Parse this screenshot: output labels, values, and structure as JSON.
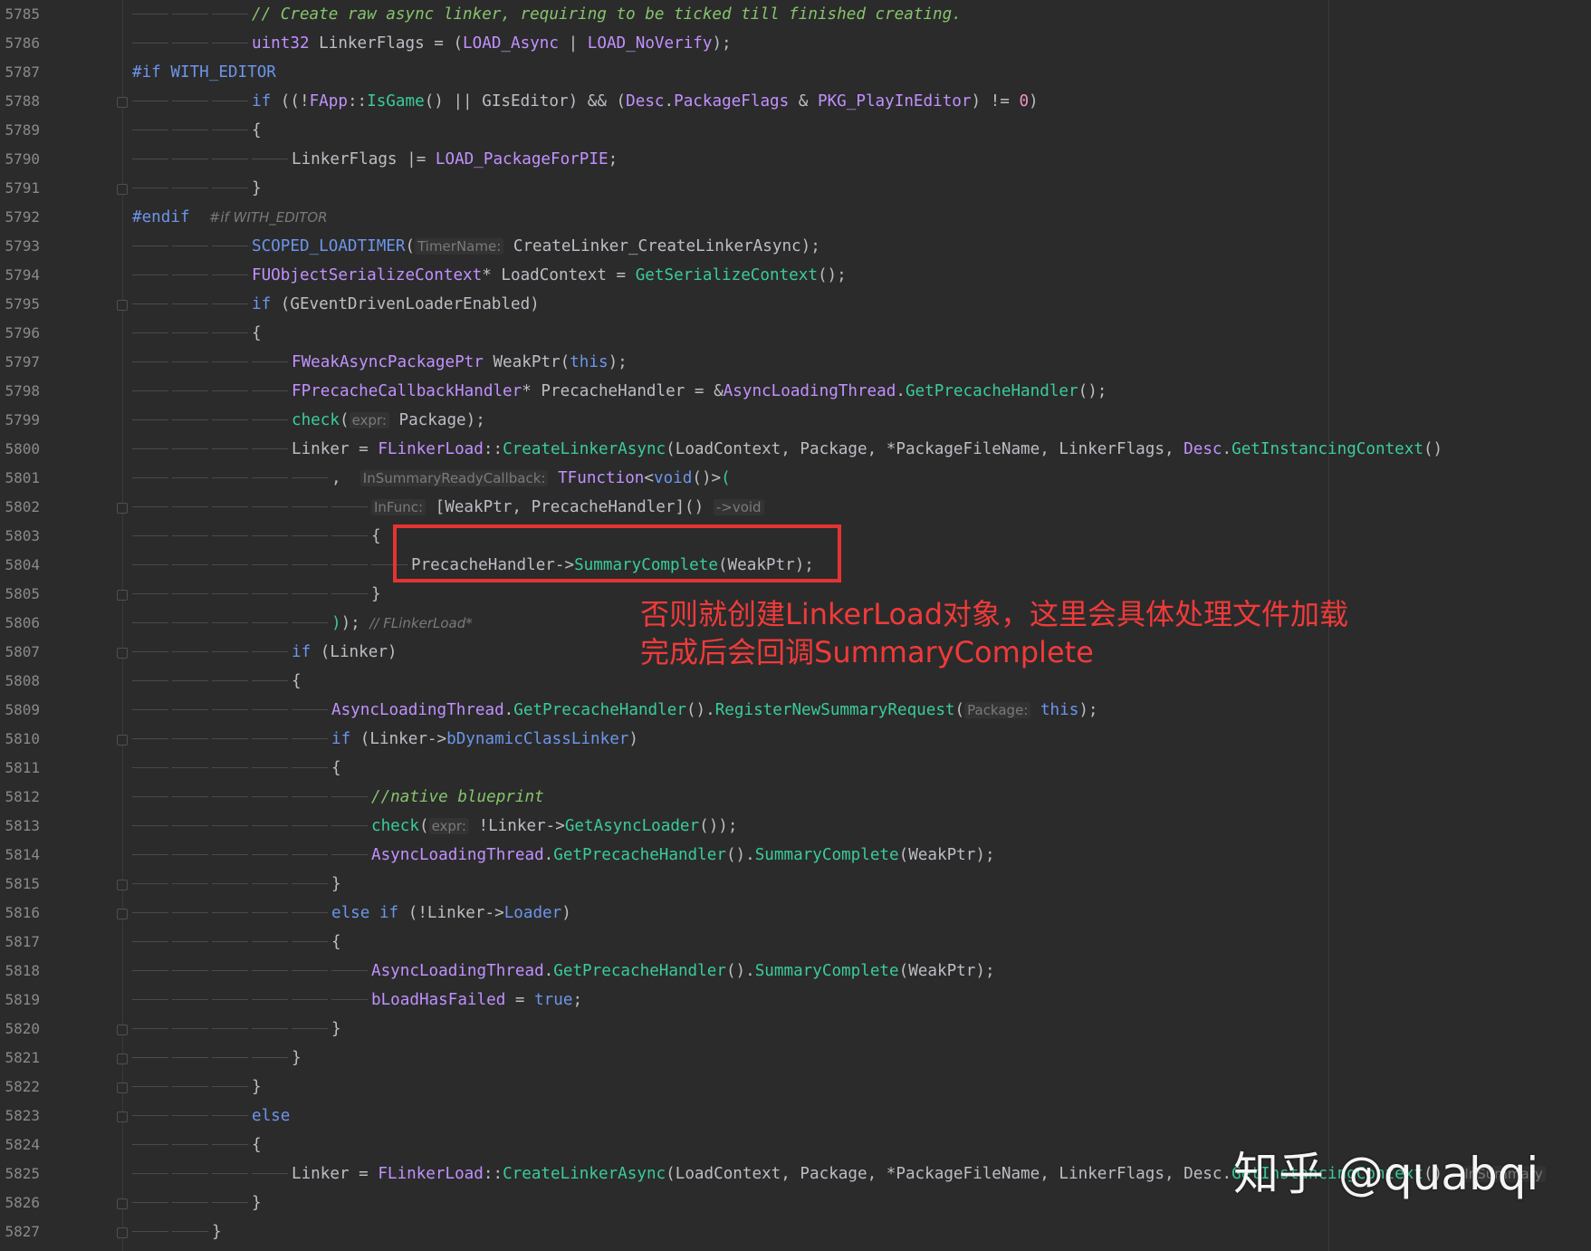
{
  "editor": {
    "lines": [
      {
        "num": "5785",
        "indent": 3,
        "fold": false,
        "tokens": [
          [
            "cm",
            "// Create raw async linker, requiring to be ticked till finished creating."
          ]
        ]
      },
      {
        "num": "5786",
        "indent": 3,
        "fold": false,
        "tokens": [
          [
            "ty",
            "uint32"
          ],
          [
            "pun",
            " LinkerFlags = "
          ],
          [
            "pun",
            "("
          ],
          [
            "ty",
            "LOAD_Async"
          ],
          [
            "pun",
            " | "
          ],
          [
            "ty",
            "LOAD_NoVerify"
          ],
          [
            "pun",
            ");"
          ]
        ]
      },
      {
        "num": "5787",
        "indent": 0,
        "fold": false,
        "tokens": [
          [
            "kw",
            "#if WITH_EDITOR"
          ]
        ]
      },
      {
        "num": "5788",
        "indent": 3,
        "fold": true,
        "tokens": [
          [
            "kw",
            "if"
          ],
          [
            "pun",
            " ((!"
          ],
          [
            "ty",
            "FApp"
          ],
          [
            "pun",
            "::"
          ],
          [
            "fn",
            "IsGame"
          ],
          [
            "pun",
            "() || GIsEditor) && ("
          ],
          [
            "ty",
            "Desc"
          ],
          [
            "pun",
            "."
          ],
          [
            "ty",
            "PackageFlags"
          ],
          [
            "pun",
            " & "
          ],
          [
            "ty",
            "PKG_PlayInEditor"
          ],
          [
            "pun",
            ") != "
          ],
          [
            "num",
            "0"
          ],
          [
            "pun",
            ")"
          ]
        ]
      },
      {
        "num": "5789",
        "indent": 3,
        "fold": false,
        "tokens": [
          [
            "pun",
            "{"
          ]
        ]
      },
      {
        "num": "5790",
        "indent": 4,
        "fold": false,
        "tokens": [
          [
            "pun",
            "LinkerFlags |= "
          ],
          [
            "ty",
            "LOAD_PackageForPIE"
          ],
          [
            "pun",
            ";"
          ]
        ]
      },
      {
        "num": "5791",
        "indent": 3,
        "fold": true,
        "tokens": [
          [
            "pun",
            "}"
          ]
        ]
      },
      {
        "num": "5792",
        "indent": 0,
        "fold": false,
        "tokens": [
          [
            "kw",
            "#endif"
          ],
          [
            "pun",
            "  "
          ],
          [
            "hintc",
            "#if WITH_EDITOR"
          ]
        ]
      },
      {
        "num": "5793",
        "indent": 3,
        "fold": false,
        "tokens": [
          [
            "mac",
            "SCOPED_LOADTIMER"
          ],
          [
            "pun",
            "("
          ],
          [
            "hint",
            "TimerName:"
          ],
          [
            "pun",
            " CreateLinker_CreateLinkerAsync);"
          ]
        ]
      },
      {
        "num": "5794",
        "indent": 3,
        "fold": false,
        "tokens": [
          [
            "ty",
            "FUObjectSerializeContext"
          ],
          [
            "pun",
            "* LoadContext = "
          ],
          [
            "fn",
            "GetSerializeContext"
          ],
          [
            "pun",
            "();"
          ]
        ]
      },
      {
        "num": "5795",
        "indent": 3,
        "fold": true,
        "tokens": [
          [
            "kw",
            "if"
          ],
          [
            "pun",
            " (GEventDrivenLoaderEnabled)"
          ]
        ]
      },
      {
        "num": "5796",
        "indent": 3,
        "fold": false,
        "tokens": [
          [
            "pun",
            "{"
          ]
        ]
      },
      {
        "num": "5797",
        "indent": 4,
        "fold": false,
        "tokens": [
          [
            "ty",
            "FWeakAsyncPackagePtr"
          ],
          [
            "pun",
            " WeakPtr("
          ],
          [
            "kw",
            "this"
          ],
          [
            "pun",
            ");"
          ]
        ]
      },
      {
        "num": "5798",
        "indent": 4,
        "fold": false,
        "tokens": [
          [
            "ty",
            "FPrecacheCallbackHandler"
          ],
          [
            "pun",
            "* PrecacheHandler = &"
          ],
          [
            "ty",
            "AsyncLoadingThread"
          ],
          [
            "pun",
            "."
          ],
          [
            "fn",
            "GetPrecacheHandler"
          ],
          [
            "pun",
            "();"
          ]
        ]
      },
      {
        "num": "5799",
        "indent": 4,
        "fold": false,
        "tokens": [
          [
            "fn",
            "check"
          ],
          [
            "pun",
            "("
          ],
          [
            "hint",
            "expr:"
          ],
          [
            "pun",
            " Package);"
          ]
        ]
      },
      {
        "num": "5800",
        "indent": 4,
        "fold": false,
        "tokens": [
          [
            "pun",
            "Linker = "
          ],
          [
            "ty",
            "FLinkerLoad"
          ],
          [
            "pun",
            "::"
          ],
          [
            "fn",
            "CreateLinkerAsync"
          ],
          [
            "pun",
            "(LoadContext, Package, *PackageFileName, LinkerFlags, "
          ],
          [
            "ty",
            "Desc"
          ],
          [
            "pun",
            "."
          ],
          [
            "fn",
            "GetInstancingContext"
          ],
          [
            "pun",
            "()"
          ]
        ]
      },
      {
        "num": "5801",
        "indent": 5,
        "fold": false,
        "tokens": [
          [
            "pun",
            ",  "
          ],
          [
            "hint",
            "InSummaryReadyCallback:"
          ],
          [
            "pun",
            " "
          ],
          [
            "ty",
            "TFunction"
          ],
          [
            "pun",
            "<"
          ],
          [
            "kw",
            "void"
          ],
          [
            "pun",
            "()>"
          ],
          [
            "fn",
            "("
          ]
        ]
      },
      {
        "num": "5802",
        "indent": 6,
        "fold": true,
        "tokens": [
          [
            "hint",
            "InFunc:"
          ],
          [
            "pun",
            " [WeakPtr, PrecacheHandler]() "
          ],
          [
            "hint",
            "->void"
          ]
        ]
      },
      {
        "num": "5803",
        "indent": 6,
        "fold": false,
        "tokens": [
          [
            "pun",
            "{"
          ]
        ]
      },
      {
        "num": "5804",
        "indent": 7,
        "fold": false,
        "tokens": [
          [
            "pun",
            "PrecacheHandler->"
          ],
          [
            "fn",
            "SummaryComplete"
          ],
          [
            "pun",
            "(WeakPtr);"
          ]
        ]
      },
      {
        "num": "5805",
        "indent": 6,
        "fold": true,
        "tokens": [
          [
            "pun",
            "}"
          ]
        ]
      },
      {
        "num": "5806",
        "indent": 5,
        "fold": false,
        "tokens": [
          [
            "fn",
            ")"
          ],
          [
            "pun",
            "); "
          ],
          [
            "hintc",
            "// FLinkerLoad*"
          ]
        ]
      },
      {
        "num": "5807",
        "indent": 4,
        "fold": true,
        "tokens": [
          [
            "kw",
            "if"
          ],
          [
            "pun",
            " (Linker)"
          ]
        ]
      },
      {
        "num": "5808",
        "indent": 4,
        "fold": false,
        "tokens": [
          [
            "pun",
            "{"
          ]
        ]
      },
      {
        "num": "5809",
        "indent": 5,
        "fold": false,
        "tokens": [
          [
            "ty",
            "AsyncLoadingThread"
          ],
          [
            "pun",
            "."
          ],
          [
            "fn",
            "GetPrecacheHandler"
          ],
          [
            "pun",
            "()."
          ],
          [
            "fn",
            "RegisterNewSummaryRequest"
          ],
          [
            "pun",
            "("
          ],
          [
            "hint",
            "Package:"
          ],
          [
            "pun",
            " "
          ],
          [
            "kw",
            "this"
          ],
          [
            "pun",
            ");"
          ]
        ]
      },
      {
        "num": "5810",
        "indent": 5,
        "fold": true,
        "tokens": [
          [
            "kw",
            "if"
          ],
          [
            "pun",
            " (Linker->"
          ],
          [
            "kw",
            "bDynamicClassLinker"
          ],
          [
            "pun",
            ")"
          ]
        ]
      },
      {
        "num": "5811",
        "indent": 5,
        "fold": false,
        "tokens": [
          [
            "pun",
            "{"
          ]
        ]
      },
      {
        "num": "5812",
        "indent": 6,
        "fold": false,
        "tokens": [
          [
            "cm",
            "//native blueprint"
          ]
        ]
      },
      {
        "num": "5813",
        "indent": 6,
        "fold": false,
        "tokens": [
          [
            "fn",
            "check"
          ],
          [
            "pun",
            "("
          ],
          [
            "hint",
            "expr:"
          ],
          [
            "pun",
            " !Linker->"
          ],
          [
            "fn",
            "GetAsyncLoader"
          ],
          [
            "pun",
            "());"
          ]
        ]
      },
      {
        "num": "5814",
        "indent": 6,
        "fold": false,
        "tokens": [
          [
            "ty",
            "AsyncLoadingThread"
          ],
          [
            "pun",
            "."
          ],
          [
            "fn",
            "GetPrecacheHandler"
          ],
          [
            "pun",
            "()."
          ],
          [
            "fn",
            "SummaryComplete"
          ],
          [
            "pun",
            "(WeakPtr);"
          ]
        ]
      },
      {
        "num": "5815",
        "indent": 5,
        "fold": true,
        "tokens": [
          [
            "pun",
            "}"
          ]
        ]
      },
      {
        "num": "5816",
        "indent": 5,
        "fold": true,
        "tokens": [
          [
            "kw",
            "else if"
          ],
          [
            "pun",
            " (!Linker->"
          ],
          [
            "kw",
            "Loader"
          ],
          [
            "pun",
            ")"
          ]
        ]
      },
      {
        "num": "5817",
        "indent": 5,
        "fold": false,
        "tokens": [
          [
            "pun",
            "{"
          ]
        ]
      },
      {
        "num": "5818",
        "indent": 6,
        "fold": false,
        "tokens": [
          [
            "ty",
            "AsyncLoadingThread"
          ],
          [
            "pun",
            "."
          ],
          [
            "fn",
            "GetPrecacheHandler"
          ],
          [
            "pun",
            "()."
          ],
          [
            "fn",
            "SummaryComplete"
          ],
          [
            "pun",
            "(WeakPtr);"
          ]
        ]
      },
      {
        "num": "5819",
        "indent": 6,
        "fold": false,
        "tokens": [
          [
            "ty",
            "bLoadHasFailed"
          ],
          [
            "pun",
            " = "
          ],
          [
            "kw",
            "true"
          ],
          [
            "pun",
            ";"
          ]
        ]
      },
      {
        "num": "5820",
        "indent": 5,
        "fold": true,
        "tokens": [
          [
            "pun",
            "}"
          ]
        ]
      },
      {
        "num": "5821",
        "indent": 4,
        "fold": true,
        "tokens": [
          [
            "pun",
            "}"
          ]
        ]
      },
      {
        "num": "5822",
        "indent": 3,
        "fold": true,
        "tokens": [
          [
            "pun",
            "}"
          ]
        ]
      },
      {
        "num": "5823",
        "indent": 3,
        "fold": true,
        "tokens": [
          [
            "kw",
            "else"
          ]
        ]
      },
      {
        "num": "5824",
        "indent": 3,
        "fold": false,
        "tokens": [
          [
            "pun",
            "{"
          ]
        ]
      },
      {
        "num": "5825",
        "indent": 4,
        "fold": false,
        "tokens": [
          [
            "pun",
            "Linker = "
          ],
          [
            "ty",
            "FLinkerLoad"
          ],
          [
            "pun",
            "::"
          ],
          [
            "fn",
            "CreateLinkerAsync"
          ],
          [
            "pun",
            "(LoadContext, Package, *PackageFileName, LinkerFlags, Desc."
          ],
          [
            "fn",
            "GetInstancingContext"
          ],
          [
            "pun",
            "(), "
          ],
          [
            "hint",
            "InSummary"
          ]
        ]
      },
      {
        "num": "5826",
        "indent": 3,
        "fold": true,
        "tokens": [
          [
            "pun",
            "}"
          ]
        ]
      },
      {
        "num": "5827",
        "indent": 2,
        "fold": true,
        "tokens": [
          [
            "pun",
            "}"
          ]
        ]
      }
    ]
  },
  "annotation": {
    "text_line1": "否则就创建LinkerLoad对象，这里会具体处理文件加载",
    "text_line2": "完成后会回调SummaryComplete"
  },
  "watermark": {
    "text": "知乎 @quabqi"
  },
  "colors": {
    "background": "#2b2b2b",
    "keyword": "#6c95eb",
    "type": "#c191ff",
    "function": "#39cc9b",
    "comment": "#85c46c",
    "number": "#ed94c0",
    "annotation": "#e53333"
  }
}
